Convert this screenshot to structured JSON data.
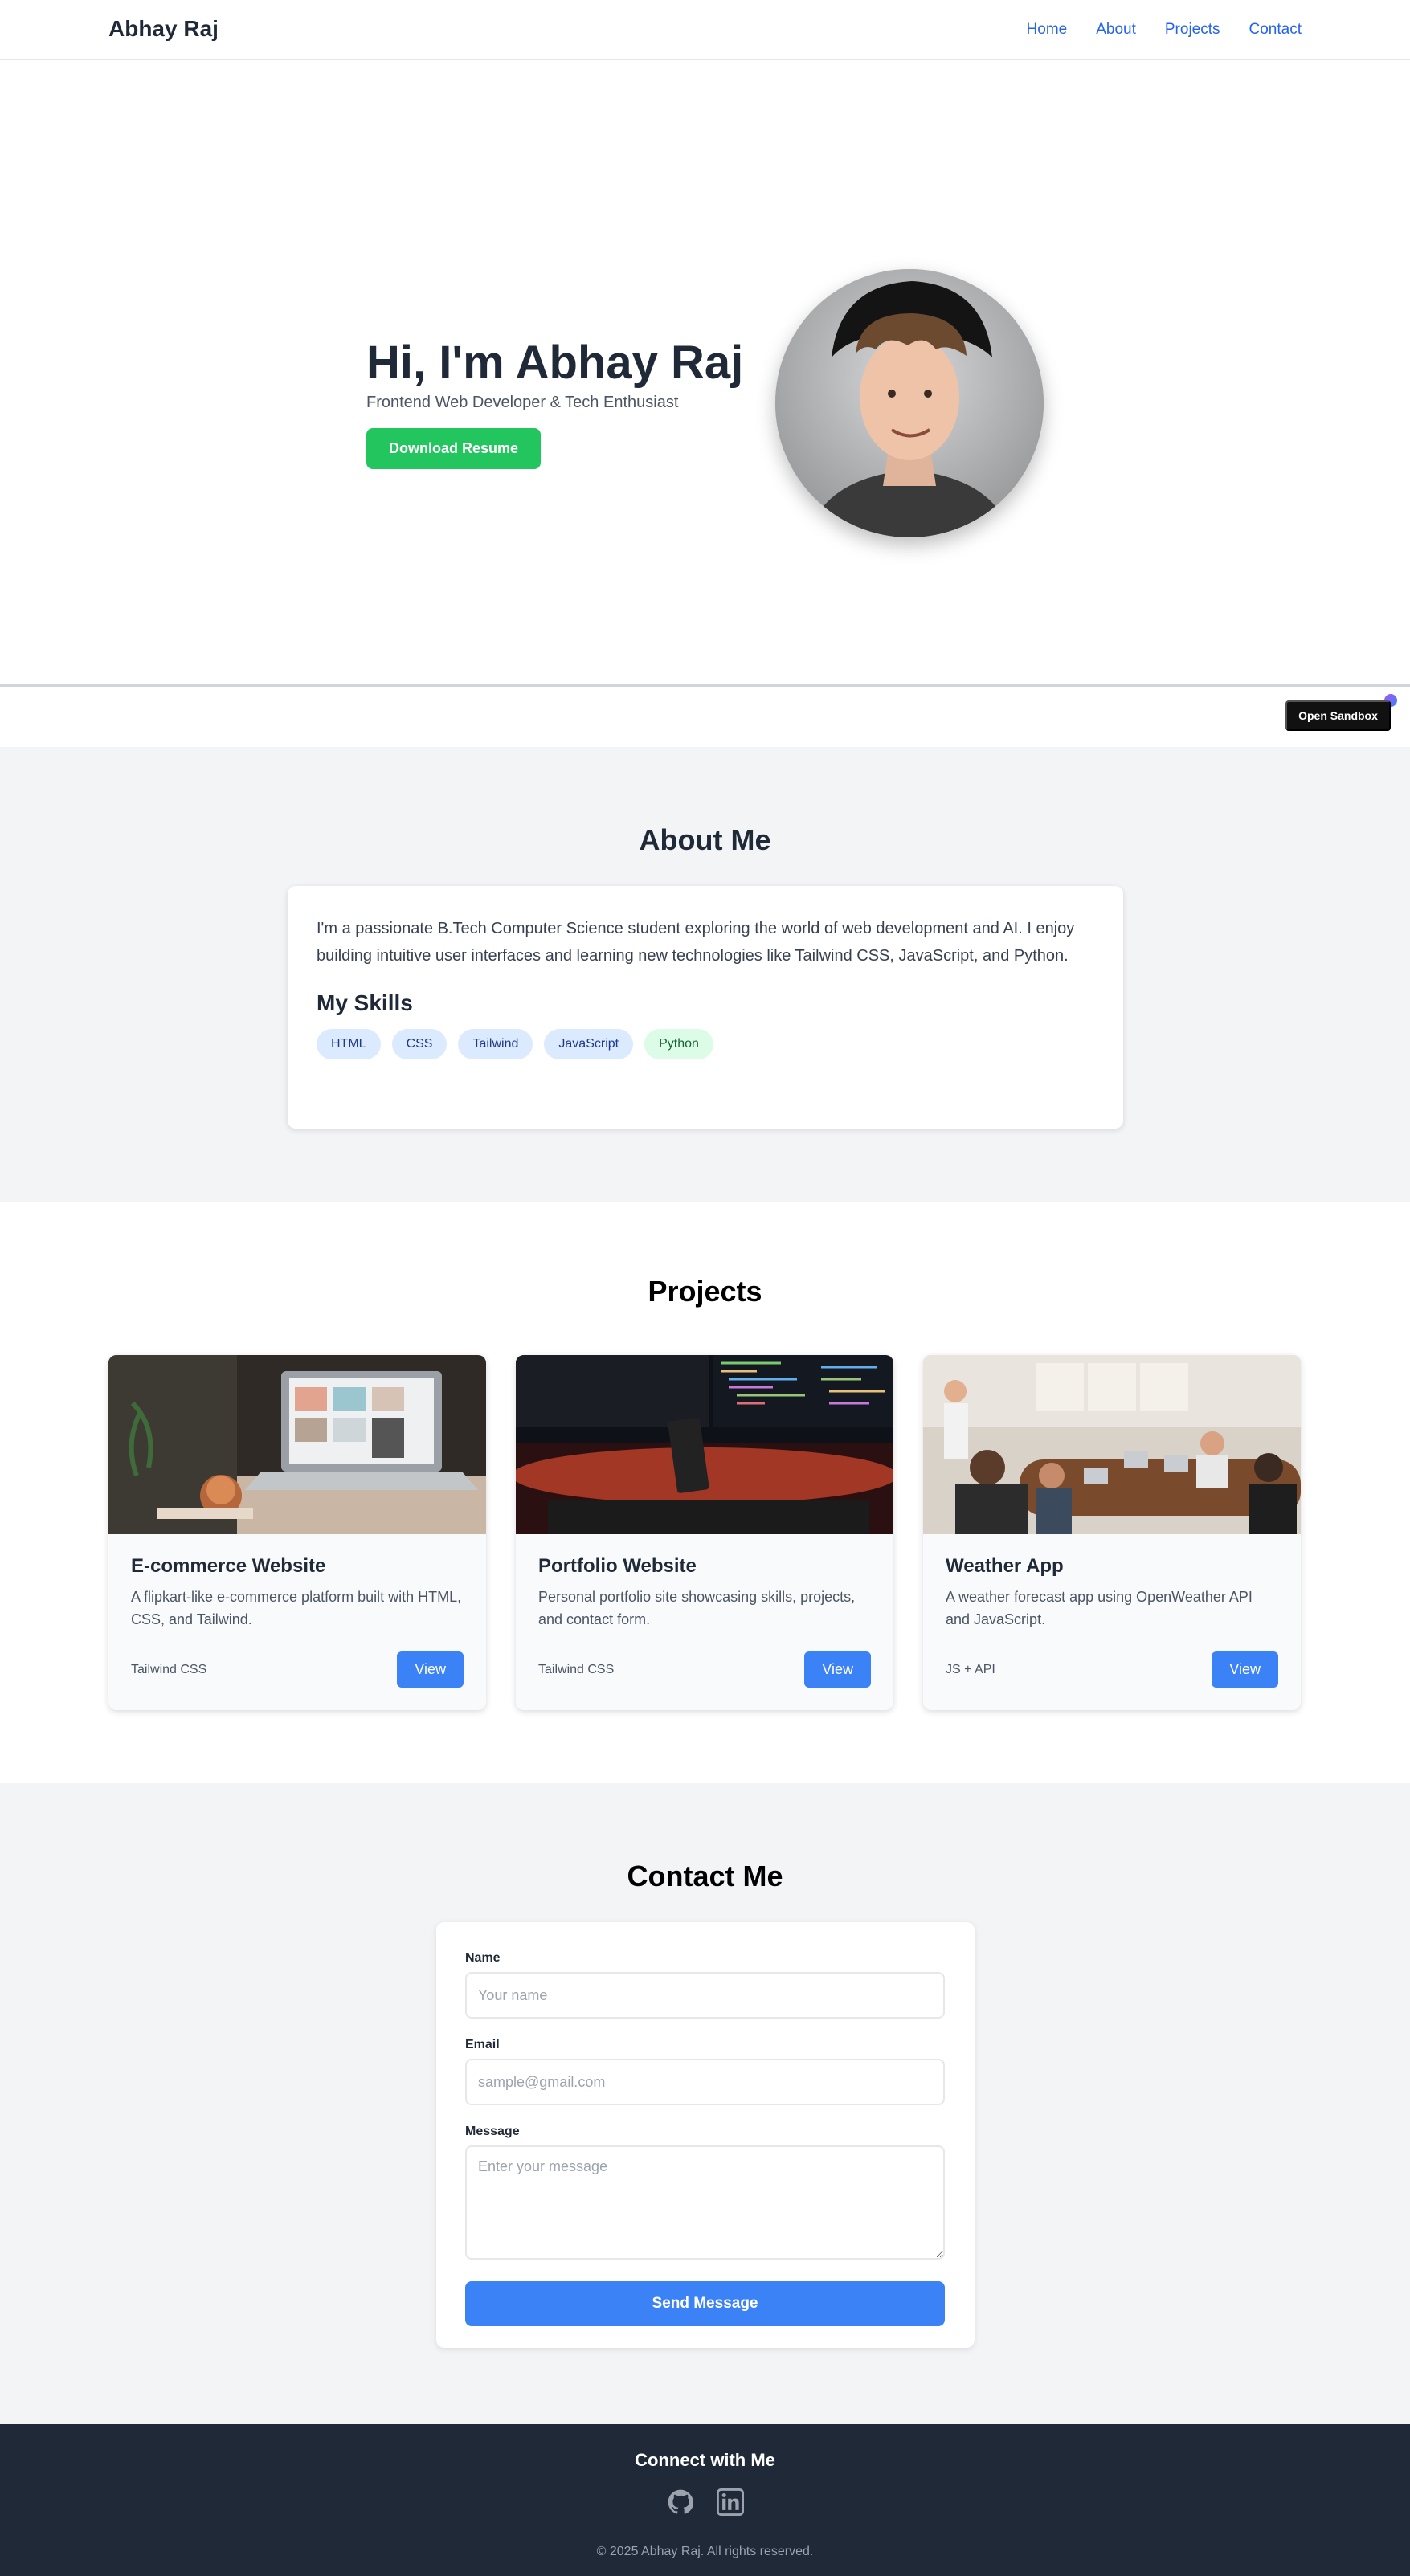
{
  "header": {
    "logo": "Abhay Raj",
    "nav": [
      "Home",
      "About",
      "Projects",
      "Contact"
    ]
  },
  "hero": {
    "title": "Hi, I'm Abhay Raj",
    "subtitle": "Frontend Web Developer & Tech Enthusiast",
    "resume_button": "Download Resume",
    "sandbox_button": "Open Sandbox"
  },
  "about": {
    "title": "About Me",
    "text": "I'm a passionate B.Tech Computer Science student exploring the world of web development and AI. I enjoy building intuitive user interfaces and learning new technologies like Tailwind CSS, JavaScript, and Python.",
    "skills_title": "My Skills",
    "skills": [
      "HTML",
      "CSS",
      "Tailwind",
      "JavaScript",
      "Python"
    ]
  },
  "projects": {
    "title": "Projects",
    "items": [
      {
        "title": "E-commerce Website",
        "desc": "A flipkart-like e-commerce platform built with HTML, CSS, and Tailwind.",
        "tag": "Tailwind CSS",
        "button": "View"
      },
      {
        "title": "Portfolio Website",
        "desc": "Personal portfolio site showcasing skills, projects, and contact form.",
        "tag": "Tailwind CSS",
        "button": "View"
      },
      {
        "title": "Weather App",
        "desc": "A weather forecast app using OpenWeather API and JavaScript.",
        "tag": "JS + API",
        "button": "View"
      }
    ]
  },
  "contact": {
    "title": "Contact Me",
    "name_label": "Name",
    "name_placeholder": "Your name",
    "email_label": "Email",
    "email_placeholder": "sample@gmail.com",
    "message_label": "Message",
    "message_placeholder": "Enter your message",
    "send_button": "Send Message"
  },
  "footer": {
    "title": "Connect with Me",
    "socials": [
      "github-icon",
      "linkedin-icon"
    ],
    "copyright": "© 2025 Abhay Raj. All rights reserved."
  },
  "colors": {
    "accent": "#3b82f6",
    "nav_link": "#2563eb",
    "resume_button": "#22c55e",
    "footer_bg": "#1f2937"
  }
}
